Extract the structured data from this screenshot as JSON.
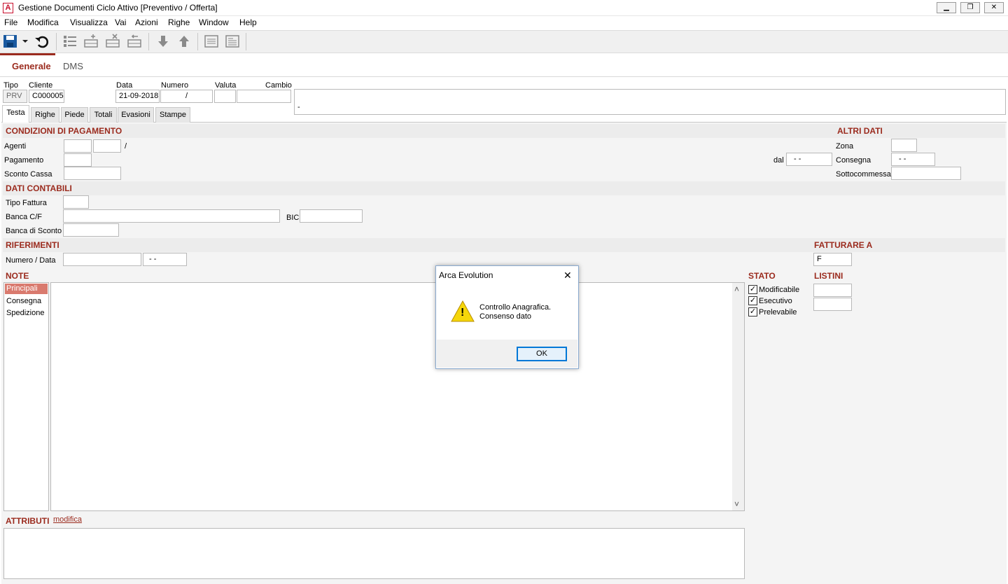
{
  "window": {
    "title": "Gestione Documenti Ciclo Attivo [Preventivo / Offerta]",
    "app_icon_letter": "A",
    "minimize_glyph": "▁",
    "restore_glyph": "❐",
    "close_glyph": "✕"
  },
  "menu": [
    "File",
    "Modifica",
    "Visualizza",
    "Vai",
    "Azioni",
    "Righe",
    "Window",
    "Help"
  ],
  "toolbar": {
    "icons": [
      "save-icon",
      "save-dropdown-icon",
      "undo-icon",
      "list-icon",
      "add-row-icon",
      "delete-row-icon",
      "insert-row-icon",
      "arrow-down-icon",
      "arrow-up-icon",
      "page-icon",
      "page-lines-icon"
    ]
  },
  "nav_tabs": [
    "Generale",
    "DMS"
  ],
  "header": {
    "tipo_label": "Tipo",
    "tipo_value": "PRV",
    "cliente_label": "Cliente",
    "cliente_value": "C000005",
    "data_label": "Data",
    "data_value": "21-09-2018",
    "numero_label": "Numero",
    "numero_value": "/",
    "valuta_label": "Valuta",
    "valuta_value": "",
    "cambio_label": "Cambio",
    "cambio_value": "",
    "description_value": "-"
  },
  "subtabs": [
    "Testa",
    "Righe",
    "Piede",
    "Totali",
    "Evasioni",
    "Stampe"
  ],
  "condizioni": {
    "title": "CONDIZIONI DI PAGAMENTO",
    "agenti_label": "Agenti",
    "agenti_sep": "/",
    "pagamento_label": "Pagamento",
    "sconto_cassa_label": "Sconto Cassa",
    "dal_label": "dal",
    "dal_value": "-  -"
  },
  "altri_dati": {
    "title": "ALTRI DATI",
    "zona_label": "Zona",
    "consegna_label": "Consegna",
    "consegna_value": "-  -",
    "sottocommessa_label": "Sottocommessa"
  },
  "dati_contabili": {
    "title": "DATI CONTABILI",
    "tipo_fattura_label": "Tipo Fattura",
    "banca_cf_label": "Banca C/F",
    "bic_label": "BIC",
    "banca_sconto_label": "Banca di Sconto"
  },
  "riferimenti": {
    "title": "RIFERIMENTI",
    "numero_data_label": "Numero / Data",
    "data_value": "-  -"
  },
  "fatturare_a": {
    "title": "FATTURARE A",
    "value": "F"
  },
  "note": {
    "title": "NOTE",
    "items": [
      "Principali",
      "Consegna",
      "Spedizione"
    ],
    "scroll_up": "˄",
    "scroll_down": "˅"
  },
  "stato": {
    "title": "STATO",
    "items": [
      {
        "label": "Modificabile",
        "checked": "✓"
      },
      {
        "label": "Esecutivo",
        "checked": "✓"
      },
      {
        "label": "Prelevabile",
        "checked": "✓"
      }
    ]
  },
  "listini": {
    "title": "LISTINI"
  },
  "attributi": {
    "title": "ATTRIBUTI",
    "link": "modifica"
  },
  "dialog": {
    "title": "Arca Evolution",
    "close_glyph": "✕",
    "message_line1": "Controllo Anagrafica.",
    "message_line2": "Consenso dato",
    "ok_label": "OK",
    "warning_glyph": "!"
  },
  "colors": {
    "accent": "#9b2b1e",
    "dialog_border": "#8aaacf",
    "ok_border": "#0078d7"
  }
}
